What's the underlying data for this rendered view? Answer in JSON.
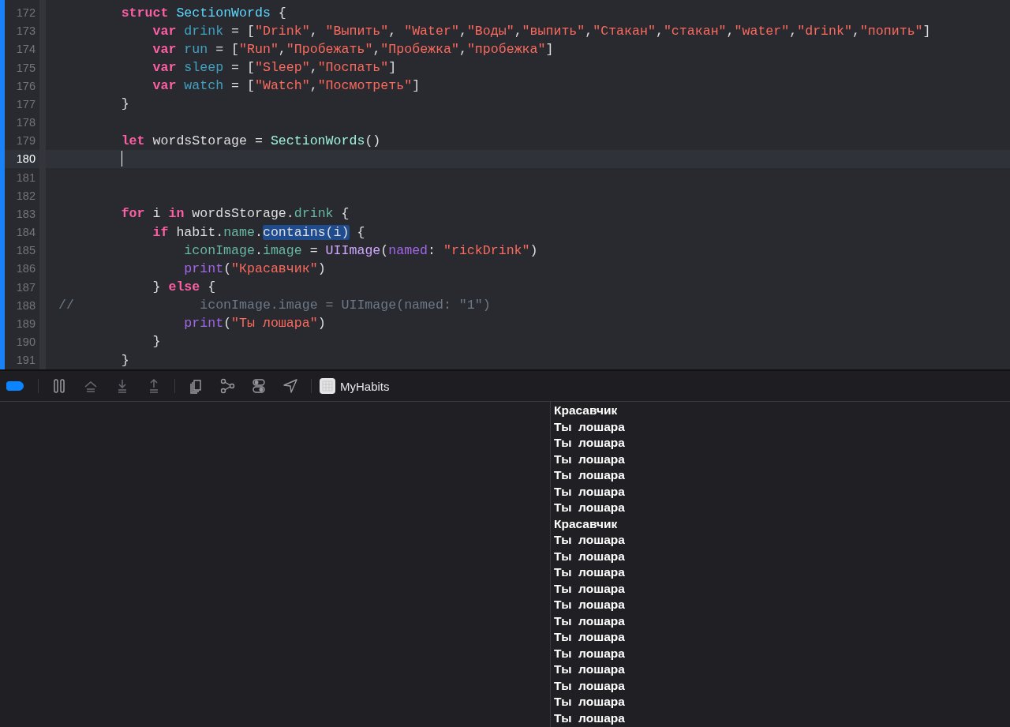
{
  "editor": {
    "lines": [
      {
        "number": "172",
        "current": false,
        "tokens": [
          {
            "kind": "keyword",
            "text": "        struct"
          },
          {
            "kind": "type_decl",
            "text": " SectionWords"
          },
          {
            "kind": "plain",
            "text": " {"
          }
        ]
      },
      {
        "number": "173",
        "current": false,
        "tokens": [
          {
            "kind": "keyword",
            "text": "            var"
          },
          {
            "kind": "property",
            "text": " drink"
          },
          {
            "kind": "plain",
            "text": " = ["
          },
          {
            "kind": "string",
            "text": "\"Drink\""
          },
          {
            "kind": "plain",
            "text": ", "
          },
          {
            "kind": "string",
            "text": "\"Выпить\""
          },
          {
            "kind": "plain",
            "text": ", "
          },
          {
            "kind": "string",
            "text": "\"Water\""
          },
          {
            "kind": "plain",
            "text": ","
          },
          {
            "kind": "string",
            "text": "\"Воды\""
          },
          {
            "kind": "plain",
            "text": ","
          },
          {
            "kind": "string",
            "text": "\"выпить\""
          },
          {
            "kind": "plain",
            "text": ","
          },
          {
            "kind": "string",
            "text": "\"Стакан\""
          },
          {
            "kind": "plain",
            "text": ","
          },
          {
            "kind": "string",
            "text": "\"стакан\""
          },
          {
            "kind": "plain",
            "text": ","
          },
          {
            "kind": "string",
            "text": "\"water\""
          },
          {
            "kind": "plain",
            "text": ","
          },
          {
            "kind": "string",
            "text": "\"drink\""
          },
          {
            "kind": "plain",
            "text": ","
          },
          {
            "kind": "string",
            "text": "\"попить\""
          },
          {
            "kind": "plain",
            "text": "]"
          }
        ]
      },
      {
        "number": "174",
        "current": false,
        "tokens": [
          {
            "kind": "keyword",
            "text": "            var"
          },
          {
            "kind": "property",
            "text": " run"
          },
          {
            "kind": "plain",
            "text": " = ["
          },
          {
            "kind": "string",
            "text": "\"Run\""
          },
          {
            "kind": "plain",
            "text": ","
          },
          {
            "kind": "string",
            "text": "\"Пробежать\""
          },
          {
            "kind": "plain",
            "text": ","
          },
          {
            "kind": "string",
            "text": "\"Пробежка\""
          },
          {
            "kind": "plain",
            "text": ","
          },
          {
            "kind": "string",
            "text": "\"пробежка\""
          },
          {
            "kind": "plain",
            "text": "]"
          }
        ]
      },
      {
        "number": "175",
        "current": false,
        "tokens": [
          {
            "kind": "keyword",
            "text": "            var"
          },
          {
            "kind": "property",
            "text": " sleep"
          },
          {
            "kind": "plain",
            "text": " = ["
          },
          {
            "kind": "string",
            "text": "\"Sleep\""
          },
          {
            "kind": "plain",
            "text": ","
          },
          {
            "kind": "string",
            "text": "\"Поспать\""
          },
          {
            "kind": "plain",
            "text": "]"
          }
        ]
      },
      {
        "number": "176",
        "current": false,
        "tokens": [
          {
            "kind": "keyword",
            "text": "            var"
          },
          {
            "kind": "property",
            "text": " watch"
          },
          {
            "kind": "plain",
            "text": " = ["
          },
          {
            "kind": "string",
            "text": "\"Watch\""
          },
          {
            "kind": "plain",
            "text": ","
          },
          {
            "kind": "string",
            "text": "\"Посмотреть\""
          },
          {
            "kind": "plain",
            "text": "]"
          }
        ]
      },
      {
        "number": "177",
        "current": false,
        "tokens": [
          {
            "kind": "plain",
            "text": "        }"
          }
        ]
      },
      {
        "number": "178",
        "current": false
      },
      {
        "number": "179",
        "current": false,
        "tokens": [
          {
            "kind": "keyword",
            "text": "        let"
          },
          {
            "kind": "plain",
            "text": " wordsStorage = "
          },
          {
            "kind": "type",
            "text": "SectionWords"
          },
          {
            "kind": "plain",
            "text": "()"
          }
        ]
      },
      {
        "number": "180",
        "current": true
      },
      {
        "number": "181",
        "current": false
      },
      {
        "number": "182",
        "current": false
      },
      {
        "number": "183",
        "current": false,
        "tokens": [
          {
            "kind": "keyword",
            "text": "        for"
          },
          {
            "kind": "plain",
            "text": " i "
          },
          {
            "kind": "keyword",
            "text": "in"
          },
          {
            "kind": "plain",
            "text": " wordsStorage."
          },
          {
            "kind": "member",
            "text": "drink"
          },
          {
            "kind": "plain",
            "text": " {"
          }
        ]
      },
      {
        "number": "184",
        "current": false,
        "tokens": [
          {
            "kind": "keyword",
            "text": "            if"
          },
          {
            "kind": "plain",
            "text": " habit."
          },
          {
            "kind": "member",
            "text": "name"
          },
          {
            "kind": "plain",
            "text": "."
          },
          {
            "kind": "selection",
            "text": "contains(i)"
          },
          {
            "kind": "plain",
            "text": " {"
          }
        ]
      },
      {
        "number": "185",
        "current": false,
        "tokens": [
          {
            "kind": "member",
            "text": "                iconImage"
          },
          {
            "kind": "plain",
            "text": "."
          },
          {
            "kind": "member",
            "text": "image"
          },
          {
            "kind": "plain",
            "text": " = "
          },
          {
            "kind": "class",
            "text": "UIImage"
          },
          {
            "kind": "plain",
            "text": "("
          },
          {
            "kind": "function",
            "text": "named"
          },
          {
            "kind": "plain",
            "text": ": "
          },
          {
            "kind": "string",
            "text": "\"rickDrink\""
          },
          {
            "kind": "plain",
            "text": ")"
          }
        ]
      },
      {
        "number": "186",
        "current": false,
        "tokens": [
          {
            "kind": "function",
            "text": "                print"
          },
          {
            "kind": "plain",
            "text": "("
          },
          {
            "kind": "string",
            "text": "\"Красавчик\""
          },
          {
            "kind": "plain",
            "text": ")"
          }
        ]
      },
      {
        "number": "187",
        "current": false,
        "tokens": [
          {
            "kind": "plain",
            "text": "            } "
          },
          {
            "kind": "keyword",
            "text": "else"
          },
          {
            "kind": "plain",
            "text": " {"
          }
        ]
      },
      {
        "number": "188",
        "current": false,
        "tokens": [
          {
            "kind": "comment",
            "text": "//                iconImage.image = UIImage(named: \"1\")"
          }
        ]
      },
      {
        "number": "189",
        "current": false,
        "tokens": [
          {
            "kind": "function",
            "text": "                print"
          },
          {
            "kind": "plain",
            "text": "("
          },
          {
            "kind": "string",
            "text": "\"Ты лошара\""
          },
          {
            "kind": "plain",
            "text": ")"
          }
        ]
      },
      {
        "number": "190",
        "current": false,
        "tokens": [
          {
            "kind": "plain",
            "text": "            }"
          }
        ]
      },
      {
        "number": "191",
        "current": false,
        "tokens": [
          {
            "kind": "plain",
            "text": "        }"
          }
        ]
      }
    ]
  },
  "debug_bar": {
    "breakpoints_on": true,
    "target": "MyHabits"
  },
  "console": {
    "lines": [
      "Красавчик",
      "Ты  лошара",
      "Ты  лошара",
      "Ты  лошара",
      "Ты  лошара",
      "Ты  лошара",
      "Ты  лошара",
      "Красавчик",
      "Ты  лошара",
      "Ты  лошара",
      "Ты  лошара",
      "Ты  лошара",
      "Ты  лошара",
      "Ты  лошара",
      "Ты  лошара",
      "Ты  лошара",
      "Ты  лошара",
      "Ты  лошара",
      "Ты  лошара",
      "Ты  лошара"
    ]
  }
}
